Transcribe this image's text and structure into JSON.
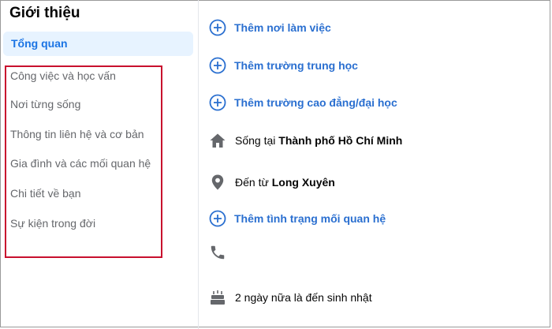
{
  "sidebar": {
    "title": "Giới thiệu",
    "active_item": "Tổng quan",
    "items": [
      "Công việc và học vấn",
      "Nơi từng sống",
      "Thông tin liên hệ và cơ bản",
      "Gia đình và các mối quan hệ",
      "Chi tiết về bạn",
      "Sự kiện trong đời"
    ]
  },
  "overview": {
    "add_workplace": "Thêm nơi làm việc",
    "add_high_school": "Thêm trường trung học",
    "add_college": "Thêm trường cao đẳng/đại học",
    "lives_in_prefix": "Sống tại",
    "lives_in_city": "Thành phố Hồ Chí Minh",
    "from_prefix": "Đến từ",
    "from_city": "Long Xuyên",
    "add_relationship": "Thêm tình trạng mối quan hệ",
    "birthday_text": "2 ngày nữa là đến sinh nhật"
  },
  "icons": {
    "add": "plus-circle-icon",
    "home": "home-icon",
    "location": "location-pin-icon",
    "phone": "phone-icon",
    "birthday": "cake-icon"
  },
  "colors": {
    "accent": "#2a6fd0",
    "active_bg": "#e7f3ff",
    "highlight_border": "#c8102e",
    "icon_gray": "#65676b"
  }
}
